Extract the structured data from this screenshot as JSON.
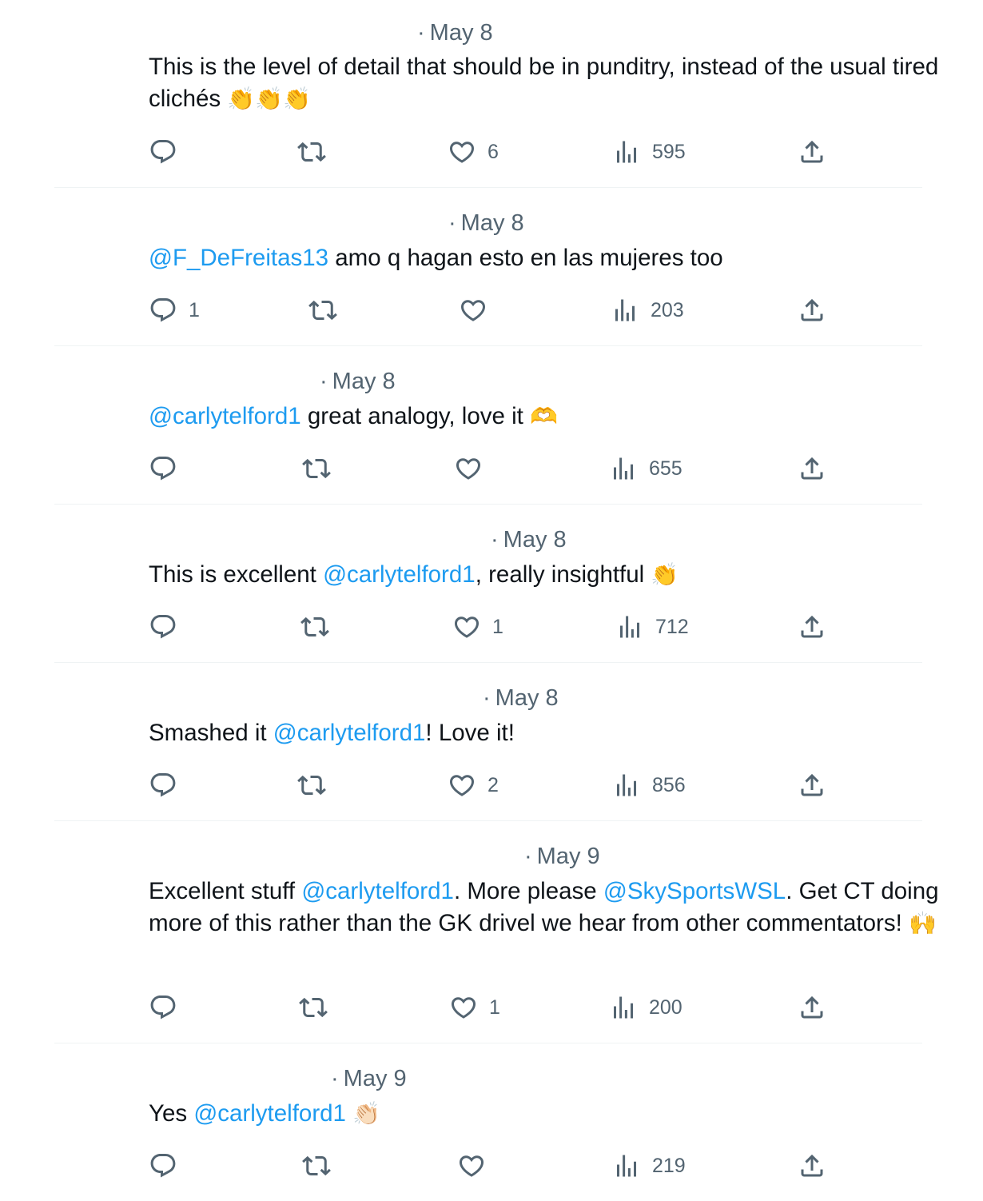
{
  "tweets": [
    {
      "time": "May 8",
      "parts": [
        {
          "t": "text",
          "v": "This is the level of detail that should be in punditry, instead of the usual tired clichés "
        },
        {
          "t": "emoji",
          "v": "👏👏👏"
        }
      ],
      "replies": "",
      "retweets": "",
      "likes": "6",
      "views": "595"
    },
    {
      "time": "May 8",
      "parts": [
        {
          "t": "mention",
          "v": "@F_DeFreitas13"
        },
        {
          "t": "text",
          "v": " amo q hagan esto en las mujeres too"
        }
      ],
      "replies": "1",
      "retweets": "",
      "likes": "",
      "views": "203"
    },
    {
      "time": "May 8",
      "parts": [
        {
          "t": "mention",
          "v": "@carlytelford1"
        },
        {
          "t": "text",
          "v": " great analogy, love it "
        },
        {
          "t": "emoji",
          "v": "🫶"
        }
      ],
      "replies": "",
      "retweets": "",
      "likes": "",
      "views": "655"
    },
    {
      "time": "May 8",
      "parts": [
        {
          "t": "text",
          "v": "This is excellent "
        },
        {
          "t": "mention",
          "v": "@carlytelford1"
        },
        {
          "t": "text",
          "v": ", really insightful "
        },
        {
          "t": "emoji",
          "v": "👏"
        }
      ],
      "replies": "",
      "retweets": "",
      "likes": "1",
      "views": "712"
    },
    {
      "time": "May 8",
      "parts": [
        {
          "t": "text",
          "v": "Smashed it "
        },
        {
          "t": "mention",
          "v": "@carlytelford1"
        },
        {
          "t": "text",
          "v": "! Love it!"
        }
      ],
      "replies": "",
      "retweets": "",
      "likes": "2",
      "views": "856"
    },
    {
      "time": "May 9",
      "parts": [
        {
          "t": "text",
          "v": "Excellent stuff "
        },
        {
          "t": "mention",
          "v": "@carlytelford1"
        },
        {
          "t": "text",
          "v": ". More please "
        },
        {
          "t": "mention",
          "v": "@SkySportsWSL"
        },
        {
          "t": "text",
          "v": ". Get CT doing more of this rather than the GK drivel we hear from other commentators! "
        },
        {
          "t": "emoji",
          "v": "🙌"
        }
      ],
      "replies": "",
      "retweets": "",
      "likes": "1",
      "views": "200"
    },
    {
      "time": "May 9",
      "parts": [
        {
          "t": "text",
          "v": "Yes "
        },
        {
          "t": "mention",
          "v": "@carlytelford1"
        },
        {
          "t": "text",
          "v": " "
        },
        {
          "t": "emoji",
          "v": "👏🏻"
        }
      ],
      "replies": "",
      "retweets": "",
      "likes": "",
      "views": "219"
    }
  ],
  "icons": {
    "reply": "reply-icon",
    "retweet": "retweet-icon",
    "like": "heart-icon",
    "views": "views-icon",
    "share": "share-icon"
  },
  "colors": {
    "mention": "#1d9bf0",
    "secondary_text": "#536471",
    "divider": "#eff3f4"
  }
}
